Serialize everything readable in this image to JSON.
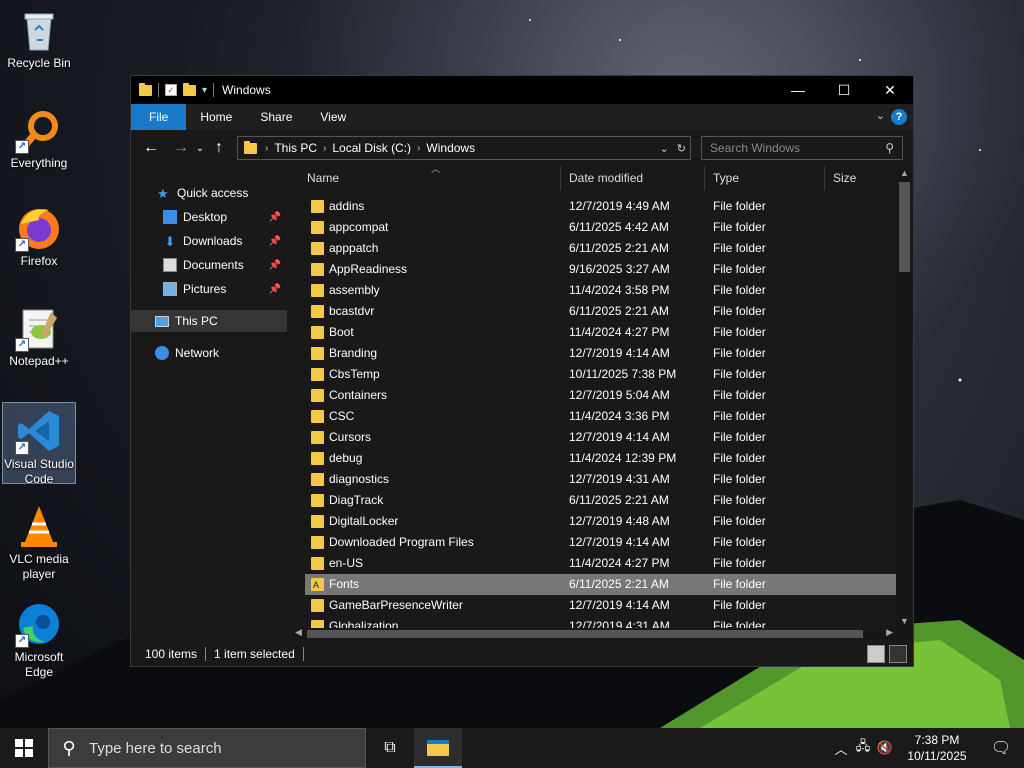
{
  "desktop": {
    "icons": [
      {
        "label": "Recycle Bin",
        "name": "recycle-bin-icon"
      },
      {
        "label": "Everything",
        "name": "everything-icon"
      },
      {
        "label": "Firefox",
        "name": "firefox-icon"
      },
      {
        "label": "Notepad++",
        "name": "notepad-plus-plus-icon"
      },
      {
        "label": "Visual Studio Code",
        "name": "vscode-icon"
      },
      {
        "label": "VLC media player",
        "name": "vlc-icon"
      },
      {
        "label": "Microsoft Edge",
        "name": "edge-icon"
      }
    ]
  },
  "window": {
    "title": "Windows",
    "ribbon": {
      "file": "File",
      "home": "Home",
      "share": "Share",
      "view": "View",
      "help": "?"
    },
    "address": {
      "crumbs": [
        "This PC",
        "Local Disk (C:)",
        "Windows"
      ]
    },
    "search_placeholder": "Search Windows",
    "nav": {
      "quick_access": "Quick access",
      "desktop": "Desktop",
      "downloads": "Downloads",
      "documents": "Documents",
      "pictures": "Pictures",
      "this_pc": "This PC",
      "network": "Network"
    },
    "columns": {
      "name": "Name",
      "date": "Date modified",
      "type": "Type",
      "size": "Size"
    },
    "rows": [
      {
        "name": "addins",
        "date": "12/7/2019 4:49 AM",
        "type": "File folder"
      },
      {
        "name": "appcompat",
        "date": "6/11/2025 4:42 AM",
        "type": "File folder"
      },
      {
        "name": "apppatch",
        "date": "6/11/2025 2:21 AM",
        "type": "File folder"
      },
      {
        "name": "AppReadiness",
        "date": "9/16/2025 3:27 AM",
        "type": "File folder"
      },
      {
        "name": "assembly",
        "date": "11/4/2024 3:58 PM",
        "type": "File folder"
      },
      {
        "name": "bcastdvr",
        "date": "6/11/2025 2:21 AM",
        "type": "File folder"
      },
      {
        "name": "Boot",
        "date": "11/4/2024 4:27 PM",
        "type": "File folder"
      },
      {
        "name": "Branding",
        "date": "12/7/2019 4:14 AM",
        "type": "File folder"
      },
      {
        "name": "CbsTemp",
        "date": "10/11/2025 7:38 PM",
        "type": "File folder"
      },
      {
        "name": "Containers",
        "date": "12/7/2019 5:04 AM",
        "type": "File folder"
      },
      {
        "name": "CSC",
        "date": "11/4/2024 3:36 PM",
        "type": "File folder"
      },
      {
        "name": "Cursors",
        "date": "12/7/2019 4:14 AM",
        "type": "File folder"
      },
      {
        "name": "debug",
        "date": "11/4/2024 12:39 PM",
        "type": "File folder"
      },
      {
        "name": "diagnostics",
        "date": "12/7/2019 4:31 AM",
        "type": "File folder"
      },
      {
        "name": "DiagTrack",
        "date": "6/11/2025 2:21 AM",
        "type": "File folder"
      },
      {
        "name": "DigitalLocker",
        "date": "12/7/2019 4:48 AM",
        "type": "File folder"
      },
      {
        "name": "Downloaded Program Files",
        "date": "12/7/2019 4:14 AM",
        "type": "File folder"
      },
      {
        "name": "en-US",
        "date": "11/4/2024 4:27 PM",
        "type": "File folder"
      },
      {
        "name": "Fonts",
        "date": "6/11/2025 2:21 AM",
        "type": "File folder",
        "selected": true
      },
      {
        "name": "GameBarPresenceWriter",
        "date": "12/7/2019 4:14 AM",
        "type": "File folder"
      },
      {
        "name": "Globalization",
        "date": "12/7/2019 4:31 AM",
        "type": "File folder"
      }
    ],
    "status": {
      "count": "100 items",
      "selected": "1 item selected"
    }
  },
  "taskbar": {
    "search_placeholder": "Type here to search",
    "time": "7:38 PM",
    "date": "10/11/2025"
  },
  "colors": {
    "accent": "#1979ca",
    "folder": "#f3c947",
    "selection": "#777777"
  }
}
